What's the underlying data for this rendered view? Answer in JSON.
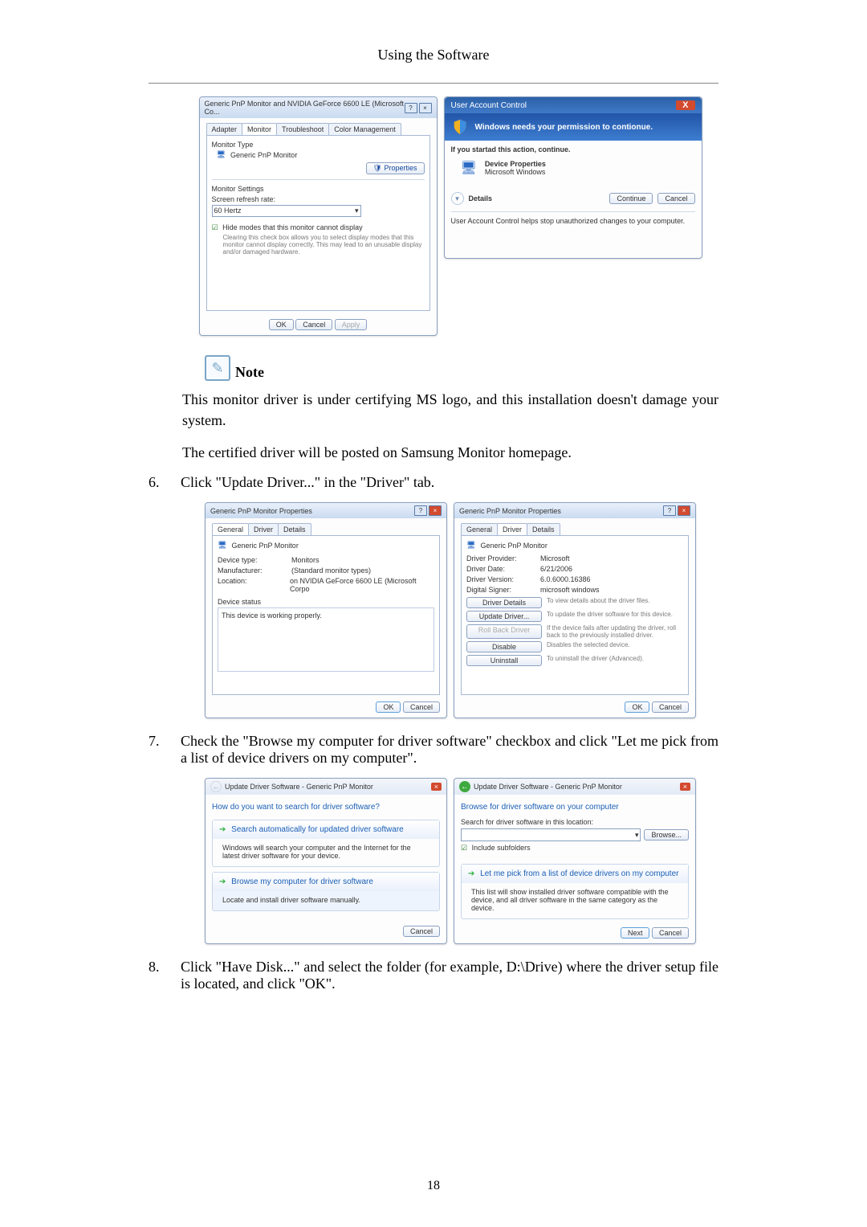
{
  "page": {
    "header": "Using the Software",
    "number": "18"
  },
  "monitor_dialog": {
    "title": "Generic PnP Monitor and NVIDIA GeForce 6600 LE (Microsoft Co...",
    "tabs": {
      "adapter": "Adapter",
      "monitor": "Monitor",
      "troubleshoot": "Troubleshoot",
      "color": "Color Management"
    },
    "monitor_type_label": "Monitor Type",
    "monitor_type_value": "Generic PnP Monitor",
    "properties_btn": "Properties",
    "monitor_settings_label": "Monitor Settings",
    "refresh_label": "Screen refresh rate:",
    "refresh_value": "60 Hertz",
    "hide_modes": "Hide modes that this monitor cannot display",
    "hide_modes_help": "Clearing this check box allows you to select display modes that this monitor cannot display correctly. This may lead to an unusable display and/or damaged hardware.",
    "ok": "OK",
    "cancel": "Cancel",
    "apply": "Apply"
  },
  "uac": {
    "title": "User Account Control",
    "close": "X",
    "banner": "Windows needs your permission to contionue.",
    "started": "If you startad this action, continue.",
    "app_name": "Device Properties",
    "publisher": "Microsoft Windows",
    "details": "Details",
    "continue": "Continue",
    "cancel": "Cancel",
    "footer": "User Account Control helps stop unauthorized changes to your computer."
  },
  "note": {
    "label": "Note"
  },
  "text": {
    "line1": "This monitor driver is under certifying MS logo, and this installation doesn't damage your system.",
    "line2": "The certified driver will be posted on Samsung Monitor homepage."
  },
  "step6": {
    "num": "6.",
    "text": "Click \"Update Driver...\" in the \"Driver\" tab."
  },
  "props_general": {
    "title": "Generic PnP Monitor Properties",
    "tab_general": "General",
    "tab_driver": "Driver",
    "tab_details": "Details",
    "name": "Generic PnP Monitor",
    "device_type_k": "Device type:",
    "device_type_v": "Monitors",
    "manufacturer_k": "Manufacturer:",
    "manufacturer_v": "(Standard monitor types)",
    "location_k": "Location:",
    "location_v": "on NVIDIA GeForce 6600 LE (Microsoft Corpo",
    "status_label": "Device status",
    "status_value": "This device is working properly.",
    "ok": "OK",
    "cancel": "Cancel"
  },
  "props_driver": {
    "title": "Generic PnP Monitor Properties",
    "name": "Generic PnP Monitor",
    "provider_k": "Driver Provider:",
    "provider_v": "Microsoft",
    "date_k": "Driver Date:",
    "date_v": "6/21/2006",
    "version_k": "Driver Version:",
    "version_v": "6.0.6000.16386",
    "signer_k": "Digital Signer:",
    "signer_v": "microsoft windows",
    "btn_details": "Driver Details",
    "btn_details_d": "To view details about the driver files.",
    "btn_update": "Update Driver...",
    "btn_update_d": "To update the driver software for this device.",
    "btn_rollback": "Roll Back Driver",
    "btn_rollback_d": "If the device fails after updating the driver, roll back to the previously installed driver.",
    "btn_disable": "Disable",
    "btn_disable_d": "Disables the selected device.",
    "btn_uninstall": "Uninstall",
    "btn_uninstall_d": "To uninstall the driver (Advanced).",
    "ok": "OK",
    "cancel": "Cancel"
  },
  "step7": {
    "num": "7.",
    "text": "Check the \"Browse my computer for driver software\" checkbox and click \"Let me pick from a list of device drivers on my computer\"."
  },
  "wiz1": {
    "breadcrumb": "Update Driver Software - Generic PnP Monitor",
    "heading": "How do you want to search for driver software?",
    "opt1_title": "Search automatically for updated driver software",
    "opt1_desc": "Windows will search your computer and the Internet for the latest driver software for your device.",
    "opt2_title": "Browse my computer for driver software",
    "opt2_desc": "Locate and install driver software manually.",
    "cancel": "Cancel"
  },
  "wiz2": {
    "breadcrumb": "Update Driver Software - Generic PnP Monitor",
    "heading": "Browse for driver software on your computer",
    "search_label": "Search for driver software in this location:",
    "browse": "Browse...",
    "include_sub": "Include subfolders",
    "pick_title": "Let me pick from a list of device drivers on my computer",
    "pick_desc": "This list will show installed driver software compatible with the device, and all driver software in the same category as the device.",
    "next": "Next",
    "cancel": "Cancel"
  },
  "step8": {
    "num": "8.",
    "text": "Click \"Have Disk...\" and select the folder (for example, D:\\Drive) where the driver setup file is located, and click \"OK\"."
  }
}
